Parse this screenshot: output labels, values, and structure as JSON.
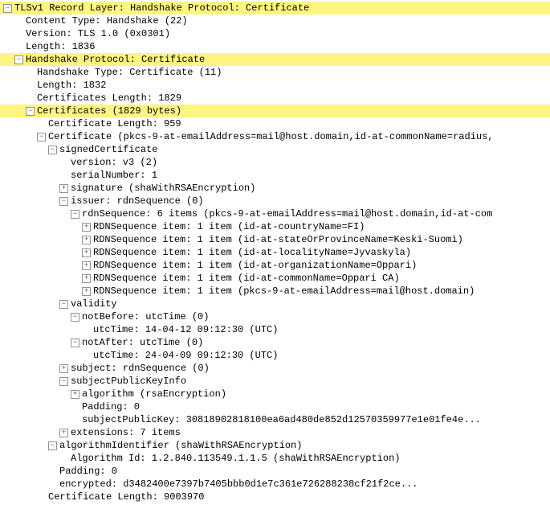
{
  "glyph": {
    "plus": "+",
    "minus": "−"
  },
  "l0": "TLSv1 Record Layer: Handshake Protocol: Certificate",
  "l1": "Content Type: Handshake (22)",
  "l2": "Version: TLS 1.0 (0x0301)",
  "l3": "Length: 1836",
  "l4": "Handshake Protocol: Certificate",
  "l5": "Handshake Type: Certificate (11)",
  "l6": "Length: 1832",
  "l7": "Certificates Length: 1829",
  "l8": "Certificates (1829 bytes)",
  "l9": "Certificate Length: 959",
  "l10": "Certificate (pkcs-9-at-emailAddress=mail@host.domain,id-at-commonName=radius,",
  "l11": "signedCertificate",
  "l12": "version: v3 (2)",
  "l13": "serialNumber: 1",
  "l14": "signature (shaWithRSAEncryption)",
  "l15": "issuer: rdnSequence (0)",
  "l16": "rdnSequence: 6 items (pkcs-9-at-emailAddress=mail@host.domain,id-at-com",
  "l17": "RDNSequence item: 1 item (id-at-countryName=FI)",
  "l18": "RDNSequence item: 1 item (id-at-stateOrProvinceName=Keski-Suomi)",
  "l19": "RDNSequence item: 1 item (id-at-localityName=Jyvaskyla)",
  "l20": "RDNSequence item: 1 item (id-at-organizationName=Oppari)",
  "l21": "RDNSequence item: 1 item (id-at-commonName=Oppari CA)",
  "l22": "RDNSequence item: 1 item (pkcs-9-at-emailAddress=mail@host.domain)",
  "l23": "validity",
  "l24": "notBefore: utcTime (0)",
  "l25": "utcTime: 14-04-12 09:12:30 (UTC)",
  "l26": "notAfter: utcTime (0)",
  "l27": "utcTime: 24-04-09 09:12:30 (UTC)",
  "l28": "subject: rdnSequence (0)",
  "l29": "subjectPublicKeyInfo",
  "l30": "algorithm (rsaEncryption)",
  "l31": "Padding: 0",
  "l32": "subjectPublicKey: 30818902818100ea6ad480de852d12570359977e1e01fe4e...",
  "l33": "extensions: 7 items",
  "l34": "algorithmIdentifier (shaWithRSAEncryption)",
  "l35": "Algorithm Id: 1.2.840.113549.1.1.5 (shaWithRSAEncryption)",
  "l36": "Padding: 0",
  "l37": "encrypted: d3482400e7397b7405bbb0d1e7c361e726288238cf21f2ce...",
  "l38": "Certificate Length: 9003970"
}
